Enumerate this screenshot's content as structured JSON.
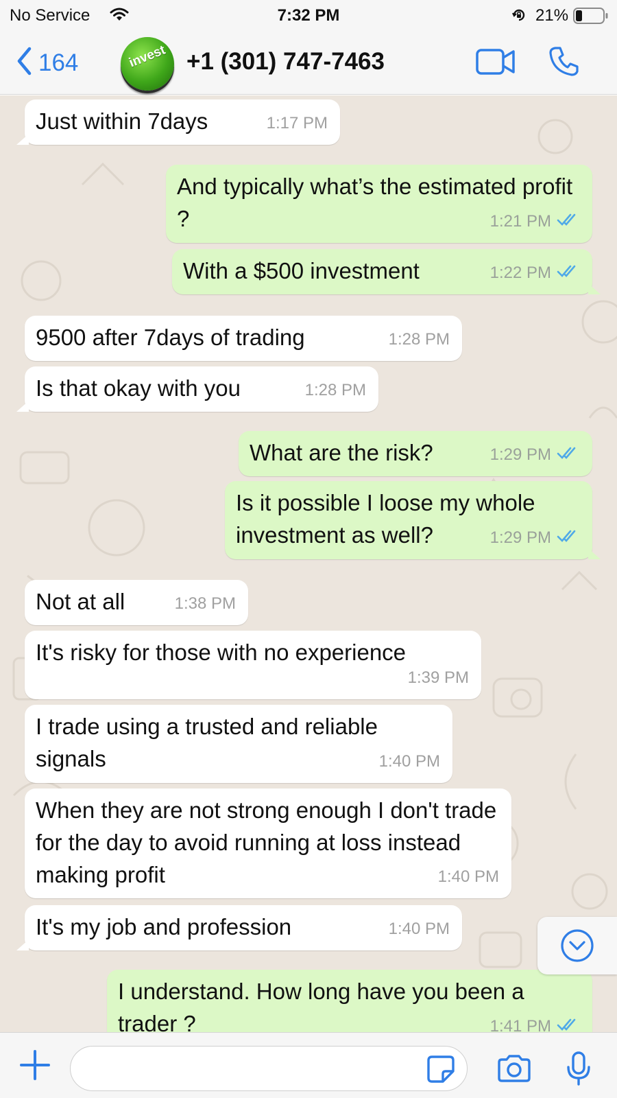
{
  "status_bar": {
    "carrier": "No Service",
    "time": "7:32 PM",
    "battery": "21%"
  },
  "header": {
    "back_count": "164",
    "avatar_text": "invest",
    "contact": "+1 (301) 747-7463"
  },
  "messages": [
    {
      "dir": "in",
      "text": "Just within 7days",
      "time": "1:17 PM"
    },
    {
      "dir": "out",
      "text": "And typically what’s the estimated profit ?",
      "time": "1:21 PM"
    },
    {
      "dir": "out",
      "text": "With a $500 investment",
      "time": "1:22 PM"
    },
    {
      "dir": "in",
      "text": "9500 after 7days of trading",
      "time": "1:28 PM"
    },
    {
      "dir": "in",
      "text": "Is that okay with you",
      "time": "1:28 PM"
    },
    {
      "dir": "out",
      "text": "What are the risk?",
      "time": "1:29 PM"
    },
    {
      "dir": "out",
      "text": "Is it possible I loose my whole investment as well?",
      "time": "1:29 PM"
    },
    {
      "dir": "in",
      "text": "Not at all",
      "time": "1:38 PM"
    },
    {
      "dir": "in",
      "text": "It's risky for those with no experience",
      "time": "1:39 PM"
    },
    {
      "dir": "in",
      "text": "I trade using a trusted and reliable signals",
      "time": "1:40 PM"
    },
    {
      "dir": "in",
      "text": "When they are not strong enough I don't trade for the day to avoid running at loss instead making profit",
      "time": "1:40 PM"
    },
    {
      "dir": "in",
      "text": "It's my job and profession",
      "time": "1:40 PM"
    },
    {
      "dir": "out",
      "text": "I understand. How long have you been a trader ?",
      "time": "1:41 PM"
    }
  ],
  "colors": {
    "accent": "#2f7ee6",
    "outgoing_bubble": "#dcf8c6",
    "incoming_bubble": "#ffffff",
    "read_ticks": "#4fa9e8",
    "chat_background": "#ece5dd"
  },
  "icons": {
    "back": "chevron-left-icon",
    "video_call": "video-camera-icon",
    "voice_call": "phone-icon",
    "scroll_down": "chevron-down-circle-icon",
    "attach": "plus-icon",
    "sticker": "sticker-icon",
    "camera": "camera-icon",
    "microphone": "microphone-icon"
  }
}
